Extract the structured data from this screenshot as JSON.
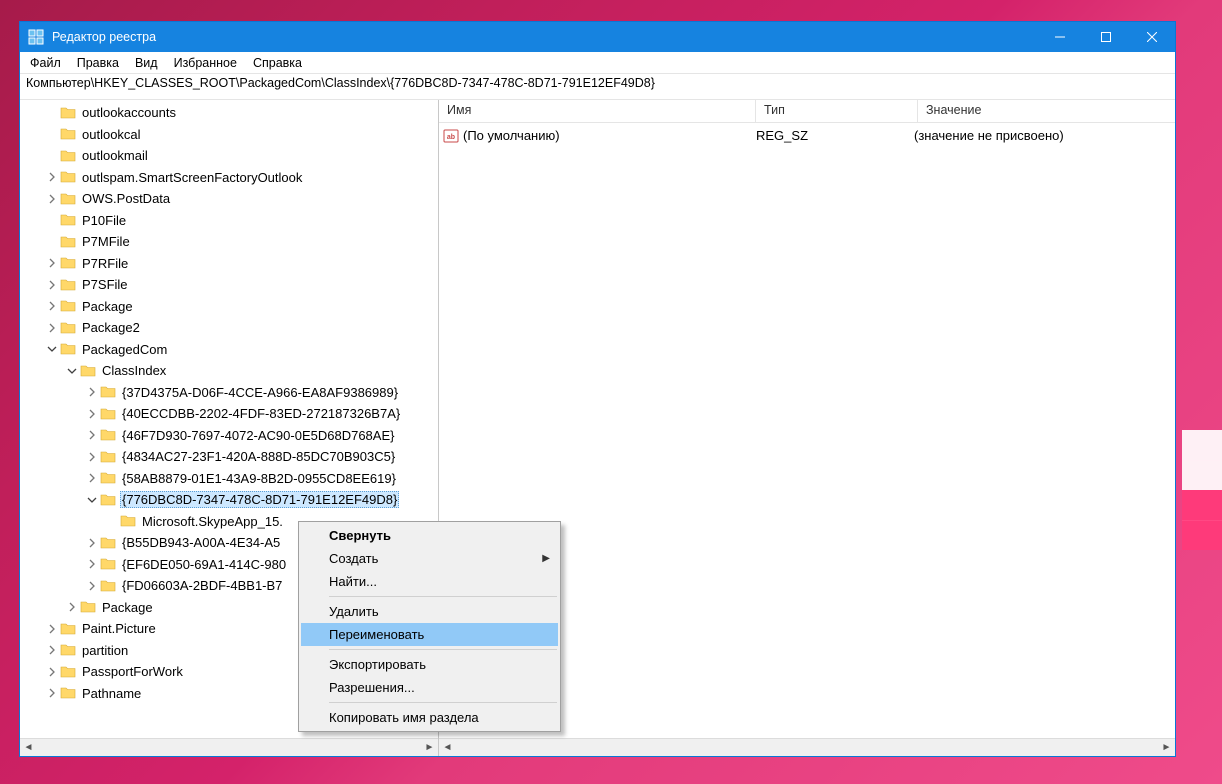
{
  "window": {
    "title": "Редактор реестра"
  },
  "menu": {
    "file": "Файл",
    "edit": "Правка",
    "view": "Вид",
    "favorites": "Избранное",
    "help": "Справка"
  },
  "address": "Компьютер\\HKEY_CLASSES_ROOT\\PackagedCom\\ClassIndex\\{776DBC8D-7347-478C-8D71-791E12EF49D8}",
  "tree": {
    "items": [
      {
        "depth": 1,
        "exp": "none",
        "label": "outlookaccounts"
      },
      {
        "depth": 1,
        "exp": "none",
        "label": "outlookcal"
      },
      {
        "depth": 1,
        "exp": "none",
        "label": "outlookmail"
      },
      {
        "depth": 1,
        "exp": "closed",
        "label": "outlspam.SmartScreenFactoryOutlook"
      },
      {
        "depth": 1,
        "exp": "closed",
        "label": "OWS.PostData"
      },
      {
        "depth": 1,
        "exp": "none",
        "label": "P10File"
      },
      {
        "depth": 1,
        "exp": "none",
        "label": "P7MFile"
      },
      {
        "depth": 1,
        "exp": "closed",
        "label": "P7RFile"
      },
      {
        "depth": 1,
        "exp": "closed",
        "label": "P7SFile"
      },
      {
        "depth": 1,
        "exp": "closed",
        "label": "Package"
      },
      {
        "depth": 1,
        "exp": "closed",
        "label": "Package2"
      },
      {
        "depth": 1,
        "exp": "open",
        "label": "PackagedCom"
      },
      {
        "depth": 2,
        "exp": "open",
        "label": "ClassIndex"
      },
      {
        "depth": 3,
        "exp": "closed",
        "label": "{37D4375A-D06F-4CCE-A966-EA8AF9386989}"
      },
      {
        "depth": 3,
        "exp": "closed",
        "label": "{40ECCDBB-2202-4FDF-83ED-272187326B7A}"
      },
      {
        "depth": 3,
        "exp": "closed",
        "label": "{46F7D930-7697-4072-AC90-0E5D68D768AE}"
      },
      {
        "depth": 3,
        "exp": "closed",
        "label": "{4834AC27-23F1-420A-888D-85DC70B903C5}"
      },
      {
        "depth": 3,
        "exp": "closed",
        "label": "{58AB8879-01E1-43A9-8B2D-0955CD8EE619}"
      },
      {
        "depth": 3,
        "exp": "open",
        "label": "{776DBC8D-7347-478C-8D71-791E12EF49D8}",
        "selected": true
      },
      {
        "depth": 4,
        "exp": "none",
        "label": "Microsoft.SkypeApp_15."
      },
      {
        "depth": 3,
        "exp": "closed",
        "label": "{B55DB943-A00A-4E34-A5"
      },
      {
        "depth": 3,
        "exp": "closed",
        "label": "{EF6DE050-69A1-414C-980"
      },
      {
        "depth": 3,
        "exp": "closed",
        "label": "{FD06603A-2BDF-4BB1-B7"
      },
      {
        "depth": 2,
        "exp": "closed",
        "label": "Package"
      },
      {
        "depth": 1,
        "exp": "closed",
        "label": "Paint.Picture"
      },
      {
        "depth": 1,
        "exp": "closed",
        "label": "partition"
      },
      {
        "depth": 1,
        "exp": "closed",
        "label": "PassportForWork"
      },
      {
        "depth": 1,
        "exp": "closed",
        "label": "Pathname"
      }
    ]
  },
  "list": {
    "columns": {
      "name": "Имя",
      "type": "Тип",
      "value": "Значение"
    },
    "rows": [
      {
        "name": "(По умолчанию)",
        "type": "REG_SZ",
        "value": "(значение не присвоено)"
      }
    ]
  },
  "context_menu": {
    "collapse": "Свернуть",
    "new": "Создать",
    "find": "Найти...",
    "delete": "Удалить",
    "rename": "Переименовать",
    "export": "Экспортировать",
    "permissions": "Разрешения...",
    "copy_key_name": "Копировать имя раздела"
  }
}
